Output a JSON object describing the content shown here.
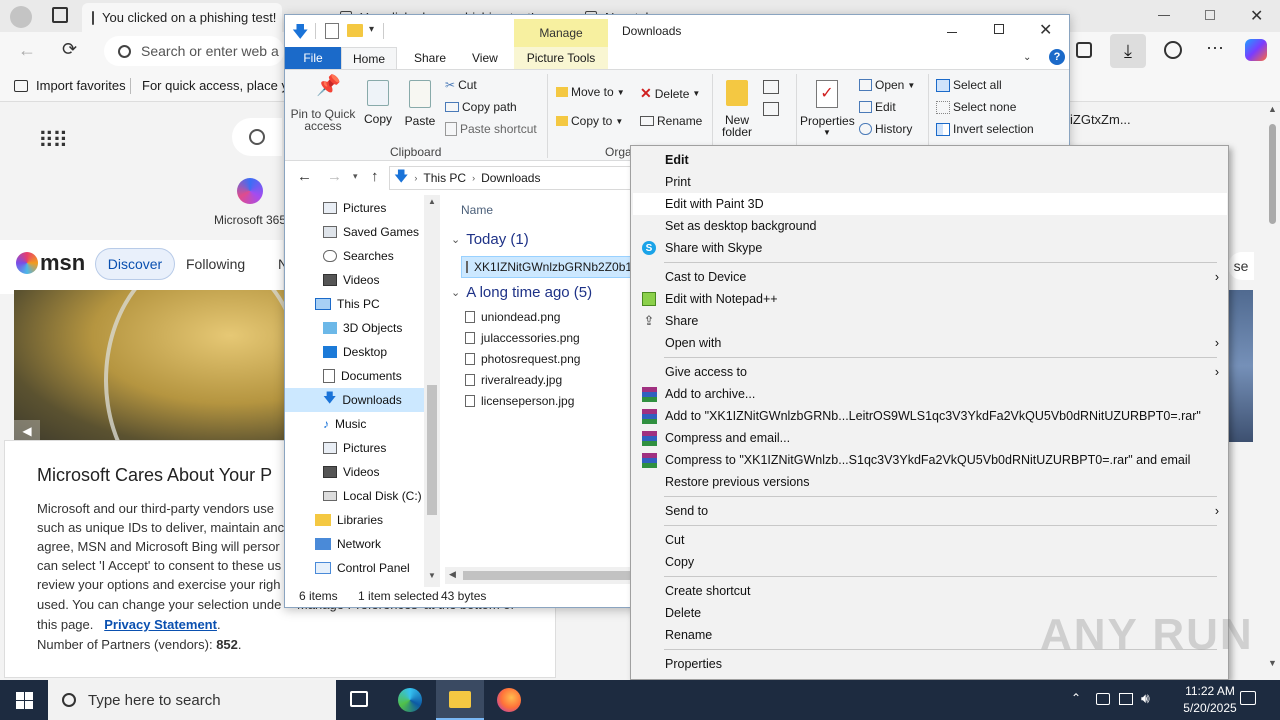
{
  "edge": {
    "tabs": [
      {
        "title": "You clicked on a phishing test!"
      },
      {
        "title": "You clicked on a phishing test!"
      },
      {
        "title": "New tab"
      }
    ],
    "address_placeholder": "Search or enter web a",
    "favorites": {
      "import": "Import favorites",
      "hint": "For quick access, place you"
    }
  },
  "msn": {
    "app_label": "Microsoft 365",
    "logo": "msn",
    "tabs": [
      "Discover",
      "Following",
      "N"
    ],
    "partial_right": "iZGtxZm...",
    "close_partial": "se",
    "consent": {
      "title": "Microsoft Cares About Your P",
      "lines": [
        "Microsoft and our third-party vendors use",
        "such as unique IDs to deliver, maintain anc",
        "agree, MSN and Microsoft Bing will persor",
        "can select 'I Accept' to consent to these us",
        "review your options and exercise your righ",
        "used. You can change your selection unde"
      ],
      "line7_partial": "Manage Preferences' at the bottom of",
      "line8_prefix": "this page.",
      "privacy_link": "Privacy Statement",
      "line8_suffix": ".",
      "partners_label": "Number of Partners (vendors): ",
      "partners_count": "852",
      "partners_suffix": "."
    }
  },
  "explorer": {
    "title": "Downloads",
    "manage_tab": "Manage",
    "ribbon_tabs": [
      "File",
      "Home",
      "Share",
      "View",
      "Picture Tools"
    ],
    "clipboard": {
      "pin": "Pin to Quick access",
      "copy": "Copy",
      "paste": "Paste",
      "cut": "Cut",
      "copy_path": "Copy path",
      "paste_shortcut": "Paste shortcut",
      "group": "Clipboard"
    },
    "organize": {
      "move_to": "Move to",
      "copy_to": "Copy to",
      "delete": "Delete",
      "rename": "Rename",
      "group": "Orga"
    },
    "new_folder": "New folder",
    "open": {
      "properties": "Properties",
      "open": "Open",
      "edit": "Edit",
      "history": "History"
    },
    "select": {
      "select_all": "Select all",
      "select_none": "Select none",
      "invert": "Invert selection"
    },
    "breadcrumb": [
      "This PC",
      "Downloads"
    ],
    "nav": [
      "Pictures",
      "Saved Games",
      "Searches",
      "Videos",
      "This PC",
      "3D Objects",
      "Desktop",
      "Documents",
      "Downloads",
      "Music",
      "Pictures",
      "Videos",
      "Local Disk (C:)",
      "Libraries",
      "Network",
      "Control Panel"
    ],
    "column_name": "Name",
    "groups": {
      "today": "Today (1)",
      "longago": "A long time ago (5)"
    },
    "selected_file": "XK1IZNitGWnlzbGRNb2Z0b1",
    "files": [
      "uniondead.png",
      "julaccessories.png",
      "photosrequest.png",
      "riveralready.jpg",
      "licenseperson.jpg"
    ],
    "status": {
      "items": "6 items",
      "selected": "1 item selected",
      "size": "43 bytes"
    }
  },
  "context_menu": {
    "items": [
      {
        "label": "Edit",
        "bold": true
      },
      {
        "label": "Print"
      },
      {
        "label": "Edit with Paint 3D",
        "highlight": true
      },
      {
        "label": "Set as desktop background"
      },
      {
        "label": "Share with Skype",
        "icon": "skype-icon"
      },
      {
        "label": "Cast to Device",
        "submenu": true
      },
      {
        "label": "Edit with Notepad++",
        "icon": "notepadpp-icon"
      },
      {
        "label": "Share",
        "icon": "share-icon"
      },
      {
        "label": "Open with",
        "submenu": true
      },
      {
        "label": "Give access to",
        "submenu": true
      },
      {
        "label": "Add to archive...",
        "icon": "winrar-icon"
      },
      {
        "label": "Add to \"XK1IZNitGWnlzbGRNb...LeitrOS9WLS1qc3V3YkdFa2VkQU5Vb0dRNitUZURBPT0=.rar\"",
        "icon": "winrar-icon"
      },
      {
        "label": "Compress and email...",
        "icon": "winrar-icon"
      },
      {
        "label": "Compress to \"XK1IZNitGWnlzb...S1qc3V3YkdFa2VkQU5Vb0dRNitUZURBPT0=.rar\" and email",
        "icon": "winrar-icon"
      },
      {
        "label": "Restore previous versions"
      },
      {
        "label": "Send to",
        "submenu": true
      },
      {
        "label": "Cut"
      },
      {
        "label": "Copy"
      },
      {
        "label": "Create shortcut"
      },
      {
        "label": "Delete"
      },
      {
        "label": "Rename"
      },
      {
        "label": "Properties"
      }
    ]
  },
  "taskbar": {
    "search_placeholder": "Type here to search",
    "time": "11:22 AM",
    "date": "5/20/2025"
  },
  "watermark": "ANY RUN",
  "colors": {
    "taskbar": "#1d2b40",
    "accent": "#0a64c8",
    "manage_tab": "#f7f0a0",
    "selection": "#cce8ff",
    "menu_highlight": "#ffffff"
  }
}
